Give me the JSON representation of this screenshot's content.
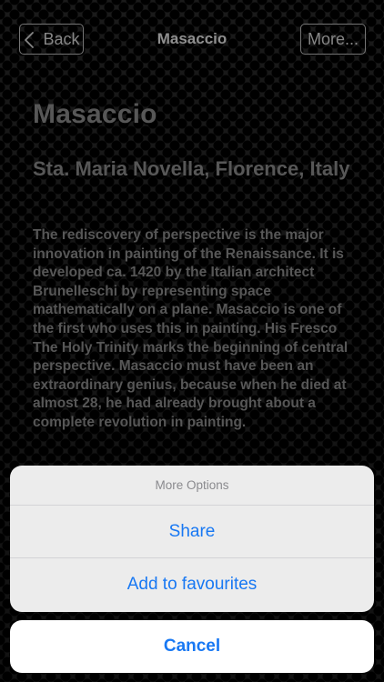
{
  "navbar": {
    "back_label": "Back",
    "title": "Masaccio",
    "more_label": "More..."
  },
  "article": {
    "title": "Masaccio",
    "location": "Sta. Maria Novella, Florence, Italy",
    "body": "The rediscovery of perspective is the major innovation in painting of the Renaissance. It is developed ca. 1420 by the Italian architect Brunelleschi by representing space mathematically on a plane. Masaccio is one of the first who uses this in painting. His Fresco The Holy Trinity marks the beginning of central perspective. Masaccio must have been an extraordinary genius, because when he died at almost 28, he had already brought about a complete revolution in painting."
  },
  "action_sheet": {
    "title": "More Options",
    "options": [
      "Share",
      "Add to favourites"
    ],
    "cancel_label": "Cancel"
  },
  "colors": {
    "accent": "#1878f3",
    "text_muted": "#8d8d8d"
  },
  "icons": {
    "back": "chevron-left-icon"
  }
}
